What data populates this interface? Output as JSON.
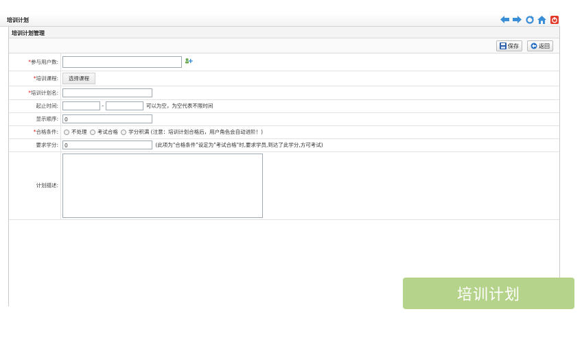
{
  "header": {
    "title": "培训计划",
    "icons": [
      "back-arrow-icon",
      "forward-arrow-icon",
      "refresh-icon",
      "home-icon",
      "power-icon"
    ]
  },
  "panel": {
    "title": "培训计划管理",
    "toolbar": {
      "save_label": "保存",
      "back_label": "返回"
    }
  },
  "form": {
    "participants": {
      "label": "参与用户数:",
      "value": ""
    },
    "courses": {
      "label": "培训课程:",
      "button_label": "选择课程"
    },
    "plan_name": {
      "label": "培训计划名:",
      "value": ""
    },
    "period": {
      "label": "起止时间:",
      "start": "",
      "end": "",
      "separator": "-",
      "hint": "可以为空，为空代表不限时间"
    },
    "display_order": {
      "label": "显示顺序:",
      "value": "0"
    },
    "pass_condition": {
      "label": "合格条件:",
      "options": [
        "不处理",
        "考试合格",
        "学分积满"
      ],
      "note": "(注意：培训计划合格后，用户角色会自动进阶！)"
    },
    "required_credits": {
      "label": "要求学分:",
      "value": "0",
      "hint": "(此项为\"合格条件\"设定为\"考试合格\"时,要求学员,到达了此学分,方可考试)"
    },
    "description": {
      "label": "计划描述:",
      "value": ""
    }
  },
  "watermark": {
    "text": "培训计划"
  },
  "colors": {
    "required": "#e01b1b",
    "watermark_bg": "#b5d38a",
    "arrow": "#3a8ed8",
    "power": "#e23b2b"
  }
}
